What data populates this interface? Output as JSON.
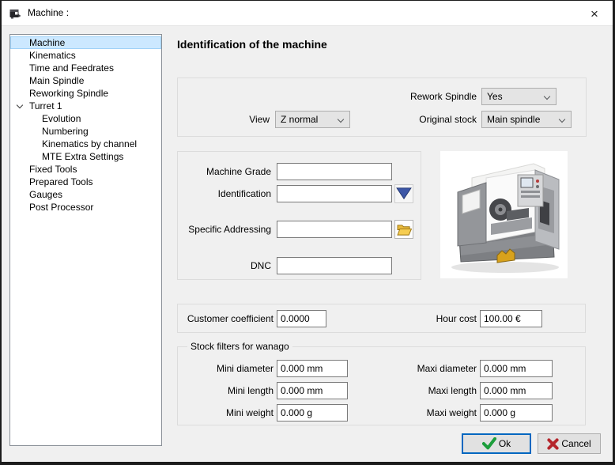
{
  "window": {
    "title": "Machine :"
  },
  "icons": {
    "close": "×"
  },
  "colors": {
    "accent_blue": "#0067c0",
    "selection_blue": "#cce8ff",
    "check_green": "#1d9e3c",
    "cancel_red": "#b5262c",
    "triangle_blue": "#3c56a6",
    "folder_gold": "#f6cd51"
  },
  "sidebar": {
    "items": [
      {
        "label": "Machine",
        "level": 0,
        "selected": true
      },
      {
        "label": "Kinematics",
        "level": 0
      },
      {
        "label": "Time and Feedrates",
        "level": 0
      },
      {
        "label": "Main Spindle",
        "level": 0
      },
      {
        "label": "Reworking Spindle",
        "level": 0
      },
      {
        "label": "Turret 1",
        "level": 0,
        "expanded": true
      },
      {
        "label": "Evolution",
        "level": 1
      },
      {
        "label": "Numbering",
        "level": 1
      },
      {
        "label": "Kinematics by channel",
        "level": 1
      },
      {
        "label": "MTE Extra Settings",
        "level": 1
      },
      {
        "label": "Fixed Tools",
        "level": 0
      },
      {
        "label": "Prepared Tools",
        "level": 0
      },
      {
        "label": "Gauges",
        "level": 0
      },
      {
        "label": "Post Processor",
        "level": 0
      }
    ]
  },
  "main": {
    "title": "Identification of the machine",
    "spindle_group": {
      "rework_spindle": {
        "label": "Rework Spindle",
        "value": "Yes"
      },
      "view": {
        "label": "View",
        "value": "Z normal"
      },
      "original_stock": {
        "label": "Original stock",
        "value": "Main spindle"
      }
    },
    "identity_group": {
      "machine_grade": {
        "label": "Machine Grade",
        "value": ""
      },
      "identification": {
        "label": "Identification",
        "value": ""
      },
      "specific_addressing": {
        "label": "Specific Addressing",
        "value": ""
      },
      "dnc": {
        "label": "DNC",
        "value": ""
      }
    },
    "cost_group": {
      "customer_coefficient": {
        "label": "Customer coefficient",
        "value": "0.0000"
      },
      "hour_cost": {
        "label": "Hour cost",
        "value": "100.00 €"
      }
    },
    "stock_filters": {
      "title": "Stock filters for wanago",
      "fields": [
        {
          "label": "Mini diameter",
          "value": "0.000 mm"
        },
        {
          "label": "Maxi diameter",
          "value": "0.000 mm"
        },
        {
          "label": "Mini length",
          "value": "0.000 mm"
        },
        {
          "label": "Maxi length",
          "value": "0.000 mm"
        },
        {
          "label": "Mini weight",
          "value": "0.000 g"
        },
        {
          "label": "Maxi weight",
          "value": "0.000 g"
        }
      ]
    }
  },
  "footer": {
    "ok": "Ok",
    "cancel": "Cancel"
  }
}
